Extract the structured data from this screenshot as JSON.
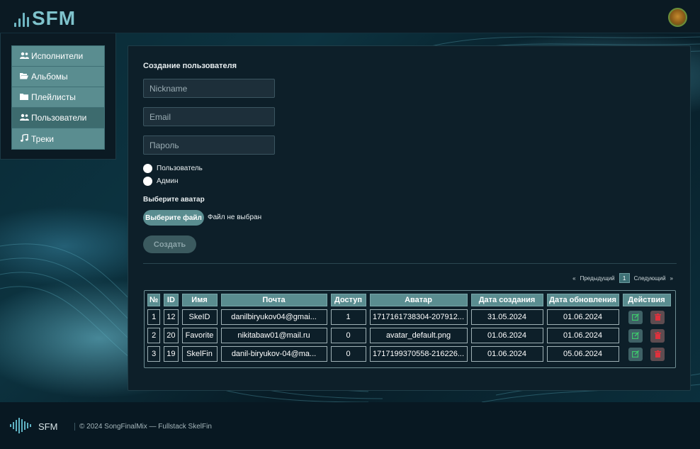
{
  "header": {
    "logo_text": "SFM",
    "avatar": "user-avatar-dog"
  },
  "sidebar": {
    "items": [
      {
        "label": "Исполнители",
        "icon": "users-icon"
      },
      {
        "label": "Альбомы",
        "icon": "folder-open-icon"
      },
      {
        "label": "Плейлисты",
        "icon": "folder-icon"
      },
      {
        "label": "Пользователи",
        "icon": "users-icon",
        "active": true
      },
      {
        "label": "Треки",
        "icon": "music-note-icon"
      }
    ]
  },
  "form": {
    "title": "Создание пользователя",
    "nickname_placeholder": "Nickname",
    "email_placeholder": "Email",
    "password_placeholder": "Пароль",
    "role_user": "Пользователь",
    "role_admin": "Админ",
    "avatar_label": "Выберите аватар",
    "file_button": "Выберите файл",
    "file_status": "Файл не выбран",
    "create_button": "Создать"
  },
  "pagination": {
    "prev": "Предыдущий",
    "current": "1",
    "next": "Следующий",
    "prev_arrow": "«",
    "next_arrow": "»"
  },
  "table": {
    "headers": [
      "№",
      "ID",
      "Имя",
      "Почта",
      "Доступ",
      "Аватар",
      "Дата создания",
      "Дата обновления",
      "Действия"
    ],
    "rows": [
      {
        "n": "1",
        "id": "12",
        "name": "SkeID",
        "email": "danilbiryukov04@gmai...",
        "access": "1",
        "avatar": "1717161738304-207912...",
        "created": "31.05.2024",
        "updated": "01.06.2024"
      },
      {
        "n": "2",
        "id": "20",
        "name": "Favorite",
        "email": "nikitabaw01@mail.ru",
        "access": "0",
        "avatar": "avatar_default.png",
        "created": "01.06.2024",
        "updated": "01.06.2024"
      },
      {
        "n": "3",
        "id": "19",
        "name": "SkelFin",
        "email": "danil-biryukov-04@ma...",
        "access": "0",
        "avatar": "1717199370558-216226...",
        "created": "01.06.2024",
        "updated": "05.06.2024"
      }
    ]
  },
  "footer": {
    "name": "SFM",
    "copyright": "© 2024 SongFinalMix — Fullstack SkelFin"
  },
  "colors": {
    "accent": "#5a8d90",
    "background": "#07141c",
    "edit": "#3ec76c",
    "delete": "#e0313d"
  }
}
